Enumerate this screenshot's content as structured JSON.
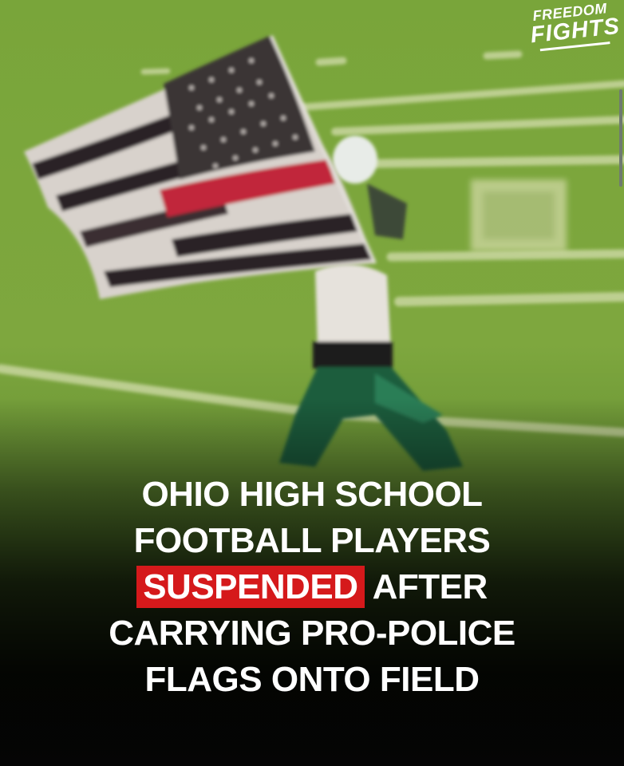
{
  "brand": {
    "line1": "FREEDOM",
    "line2": "FIGHTS"
  },
  "headline": {
    "line1": "OHIO HIGH SCHOOL",
    "line2": "FOOTBALL PLAYERS",
    "line3_highlight": "SUSPENDED",
    "line3_rest": "AFTER",
    "line4": "CARRYING PRO-POLICE",
    "line5": "FLAGS ONTO FIELD",
    "highlight_color": "#d5191b"
  },
  "photo": {
    "field_color": "#7ea73e",
    "flag_stripe_color": "#d8d2cc",
    "flag_dark_color": "#2a2426",
    "thin_line_color": "#c1273a"
  }
}
